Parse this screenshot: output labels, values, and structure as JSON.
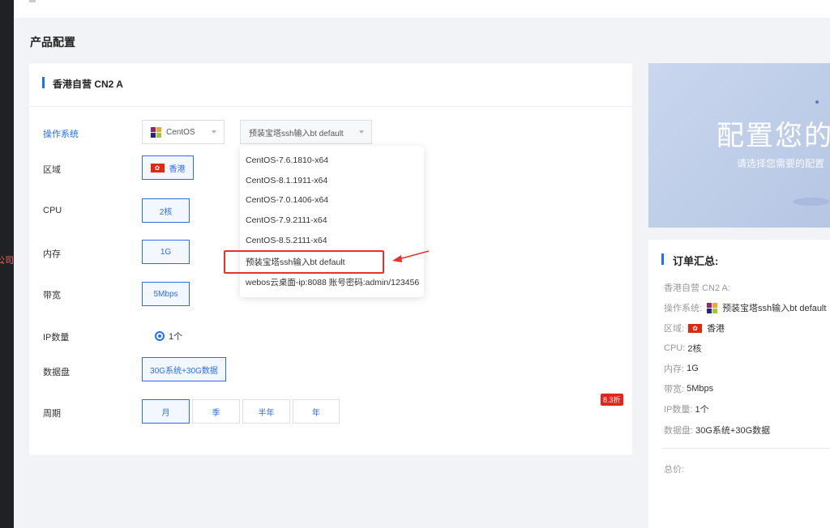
{
  "sidebar": {
    "partial_text": "公司"
  },
  "page": {
    "title": "产品配置"
  },
  "product": {
    "name": "香港自营 CN2 A"
  },
  "form": {
    "os": {
      "label": "操作系统",
      "selected_os": "CentOS",
      "selected_image": "预装宝塔ssh输入bt default",
      "options": [
        "CentOS-7.6.1810-x64",
        "CentOS-8.1.1911-x64",
        "CentOS-7.0.1406-x64",
        "CentOS-7.9.2111-x64",
        "CentOS-8.5.2111-x64",
        "预装宝塔ssh输入bt default",
        "webos云桌面-ip:8088 账号密码:admin/123456"
      ]
    },
    "region": {
      "label": "区域",
      "flag": "HK",
      "value": "香港"
    },
    "cpu": {
      "label": "CPU",
      "value": "2核"
    },
    "memory": {
      "label": "内存",
      "value": "1G"
    },
    "bandwidth": {
      "label": "带宽",
      "value": "5Mbps"
    },
    "ip": {
      "label": "IP数量",
      "value": "1个"
    },
    "disk": {
      "label": "数据盘",
      "value": "30G系统+30G数据"
    },
    "period": {
      "label": "周期",
      "options": [
        "月",
        "季",
        "半年",
        "年"
      ],
      "selected": "月",
      "discount_badge": "8.3折"
    }
  },
  "banner": {
    "title": "配置您的产",
    "subtitle": "请选择您需要的配置"
  },
  "summary": {
    "title": "订单汇总:",
    "product": "香港自营 CN2 A:",
    "os_label": "操作系统:",
    "os_value": "预装宝塔ssh输入bt default",
    "region_label": "区域:",
    "region_flag": "HK",
    "region_value": "香港",
    "cpu_label": "CPU:",
    "cpu_value": "2核",
    "memory_label": "内存:",
    "memory_value": "1G",
    "bandwidth_label": "带宽:",
    "bandwidth_value": "5Mbps",
    "ip_label": "IP数量:",
    "ip_value": "1个",
    "disk_label": "数据盘:",
    "disk_value": "30G系统+30G数据",
    "total_label": "总价:"
  },
  "colors": {
    "accent": "#1f6fff",
    "highlight": "#e8322a",
    "discount": "#e5241b"
  }
}
